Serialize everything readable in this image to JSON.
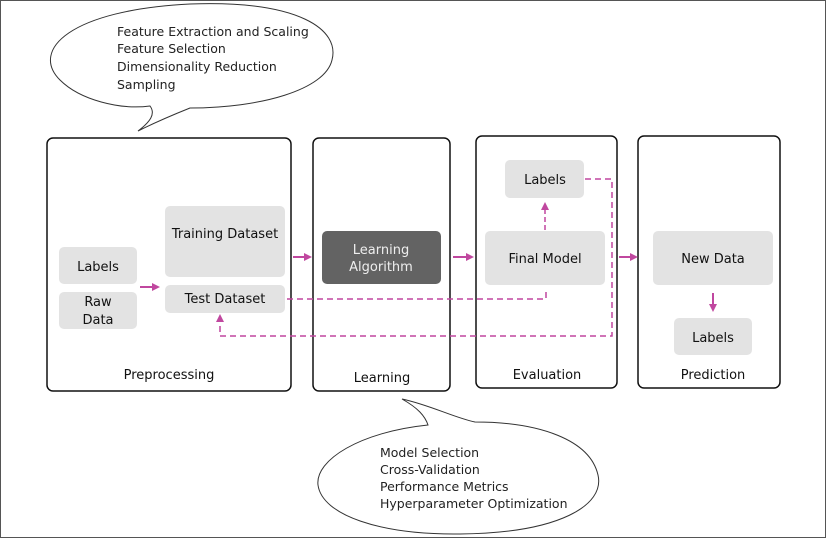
{
  "colors": {
    "accent": "#c0479f",
    "box_fill": "#e3e3e3",
    "dark_box": "#636363",
    "frame": "#111111"
  },
  "top_bubble": [
    "Feature Extraction and Scaling",
    "Feature Selection",
    "Dimensionality Reduction",
    "Sampling"
  ],
  "bottom_bubble": [
    "Model Selection",
    "Cross-Validation",
    "Performance Metrics",
    "Hyperparameter Optimization"
  ],
  "stages": {
    "preprocessing": {
      "title": "Preprocessing",
      "labels": "Labels",
      "raw_data": [
        "Raw",
        "Data"
      ],
      "training": "Training Dataset",
      "test": "Test Dataset"
    },
    "learning": {
      "title": "Learning",
      "algorithm": [
        "Learning",
        "Algorithm"
      ]
    },
    "evaluation": {
      "title": "Evaluation",
      "labels": "Labels",
      "final_model": "Final Model"
    },
    "prediction": {
      "title": "Prediction",
      "new_data": "New Data",
      "labels": "Labels"
    }
  }
}
